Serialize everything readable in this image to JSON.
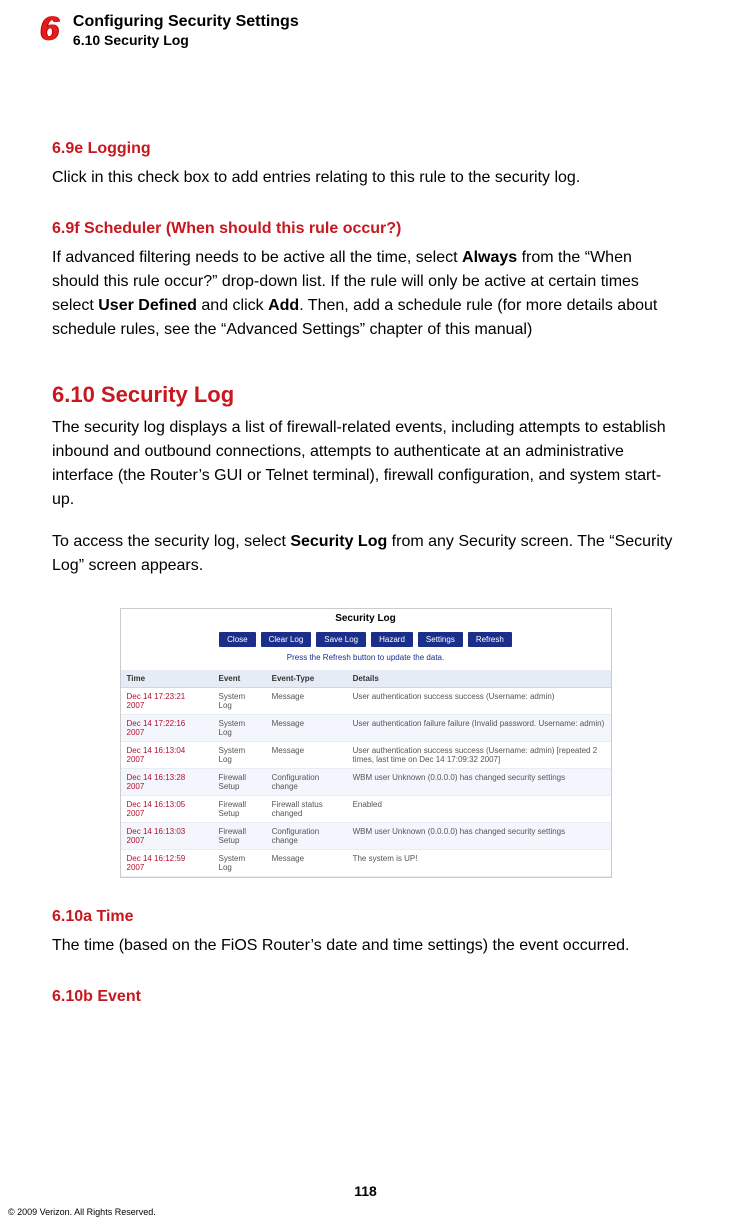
{
  "header": {
    "chapter_no": "6",
    "chapter_title": "Configuring Security Settings",
    "subsection": "6.10  Security Log"
  },
  "sections": {
    "s69e": {
      "heading": "6.9e  Logging",
      "text": "Click in this check box to add entries relating to this rule to the security log."
    },
    "s69f": {
      "heading": "6.9f  Scheduler (When should this rule occur?)",
      "p_a": "If advanced filtering needs to be active all the time, select ",
      "bold_always": "Always",
      "p_b": " from the “When should this rule occur?” drop-down list. If the rule will only be active at certain times select ",
      "bold_userdef": "User Defined",
      "p_c": " and click ",
      "bold_add": "Add",
      "p_d": ". Then, add a schedule rule (for more details about schedule rules, see the “Advanced Settings” chapter of this manual)"
    },
    "s610": {
      "heading": "6.10  Security Log",
      "p1": "The security log displays a list of firewall-related events, including attempts to establish inbound and outbound connections, attempts to authenticate at an administrative interface (the Router’s GUI or Telnet terminal), firewall configuration, and system start-up.",
      "p2_a": "To access the security log, select ",
      "p2_bold": "Security Log",
      "p2_b": " from any Security screen. The “Security Log” screen appears."
    },
    "s610a": {
      "heading": "6.10a  Time",
      "text": "The time (based on the FiOS Router’s date and time settings) the event occurred."
    },
    "s610b": {
      "heading": "6.10b  Event"
    }
  },
  "figure": {
    "title": "Security Log",
    "buttons": [
      "Close",
      "Clear Log",
      "Save Log",
      "Hazard",
      "Settings",
      "Refresh"
    ],
    "hint": "Press the Refresh button to update the data.",
    "columns": [
      "Time",
      "Event",
      "Event-Type",
      "Details"
    ],
    "rows": [
      {
        "time": "Dec 14 17:23:21\n2007",
        "event": "System Log",
        "etype": "Message",
        "details": "User authentication success success (Username: admin)"
      },
      {
        "time": "Dec 14 17:22:16\n2007",
        "event": "System Log",
        "etype": "Message",
        "details": "User authentication failure failure (Invalid password. Username: admin)"
      },
      {
        "time": "Dec 14 16:13:04\n2007",
        "event": "System Log",
        "etype": "Message",
        "details": "User authentication success success (Username: admin) [repeated 2 times, last time on Dec 14 17:09:32 2007]"
      },
      {
        "time": "Dec 14 16:13:28\n2007",
        "event": "Firewall Setup",
        "etype": "Configuration change",
        "details": "WBM user Unknown (0.0.0.0) has changed security settings"
      },
      {
        "time": "Dec 14 16:13:05\n2007",
        "event": "Firewall Setup",
        "etype": "Firewall status changed",
        "details": "Enabled"
      },
      {
        "time": "Dec 14 16:13:03\n2007",
        "event": "Firewall Setup",
        "etype": "Configuration change",
        "details": "WBM user Unknown (0.0.0.0) has changed security settings"
      },
      {
        "time": "Dec 14 16:12:59\n2007",
        "event": "System Log",
        "etype": "Message",
        "details": "The system is UP!"
      }
    ]
  },
  "footer": {
    "page": "118",
    "copyright": "© 2009 Verizon. All Rights Reserved."
  }
}
